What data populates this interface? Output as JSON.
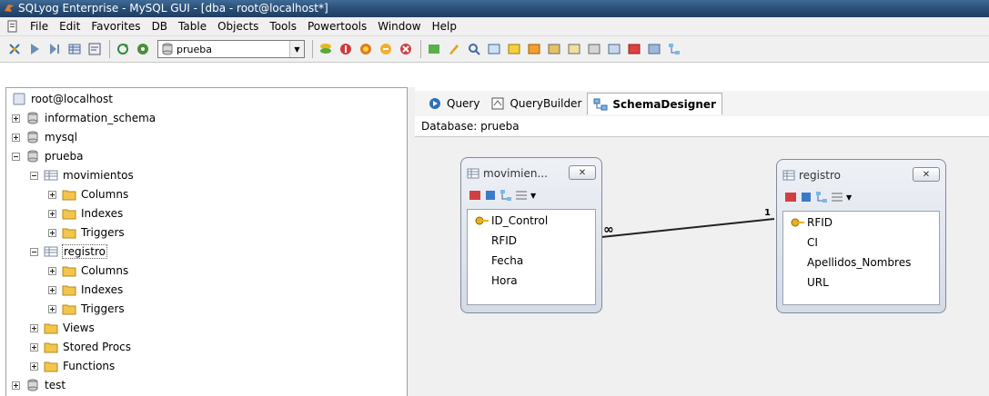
{
  "window": {
    "title": "SQLyog Enterprise - MySQL GUI - [dba - root@localhost*]"
  },
  "menu": [
    "File",
    "Edit",
    "Favorites",
    "DB",
    "Table",
    "Objects",
    "Tools",
    "Powertools",
    "Window",
    "Help"
  ],
  "toolbar": {
    "database_select": "prueba"
  },
  "tree": {
    "root": "root@localhost",
    "databases": [
      {
        "name": "information_schema"
      },
      {
        "name": "mysql"
      },
      {
        "name": "prueba"
      },
      {
        "name": "test"
      }
    ],
    "prueba_tables": [
      {
        "name": "movimientos",
        "children": [
          "Columns",
          "Indexes",
          "Triggers"
        ]
      },
      {
        "name": "registro",
        "children": [
          "Columns",
          "Indexes",
          "Triggers"
        ]
      }
    ],
    "prueba_folders": [
      "Views",
      "Stored Procs",
      "Functions"
    ]
  },
  "tabs": [
    {
      "label": "Query",
      "icon": "query-icon"
    },
    {
      "label": "QueryBuilder",
      "icon": "querybuilder-icon"
    },
    {
      "label": "SchemaDesigner",
      "icon": "schemadesigner-icon",
      "active": true
    }
  ],
  "designer": {
    "database_label": "Database: prueba",
    "tables": [
      {
        "title": "movimien...",
        "fields": [
          {
            "name": "ID_Control",
            "primary_key": true
          },
          {
            "name": "RFID"
          },
          {
            "name": "Fecha"
          },
          {
            "name": "Hora"
          }
        ]
      },
      {
        "title": "registro",
        "fields": [
          {
            "name": "RFID",
            "primary_key": true
          },
          {
            "name": "CI"
          },
          {
            "name": "Apellidos_Nombres"
          },
          {
            "name": "URL"
          }
        ]
      }
    ],
    "relation": {
      "many_label": "∞",
      "one_label": "1"
    }
  },
  "colors": {
    "titlebar": "#2a4f78",
    "folder": "#f3c54a",
    "canvas": "#f0f0f0"
  }
}
